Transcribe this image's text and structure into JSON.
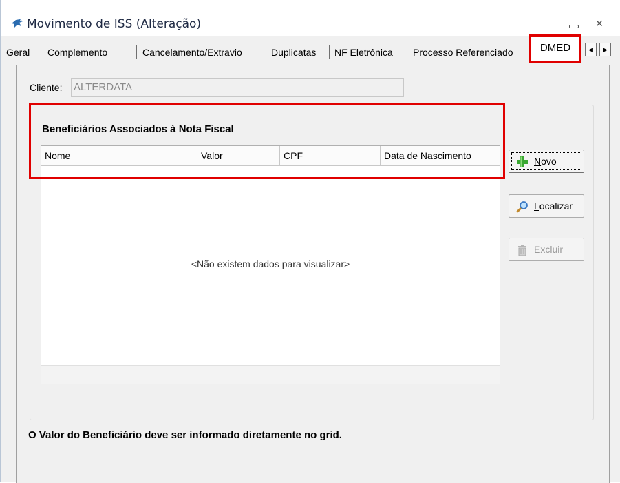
{
  "window": {
    "title": "Movimento de ISS (Alteração)",
    "min_glyph": "",
    "close_glyph": "✕"
  },
  "tabs": [
    {
      "label": "Geral"
    },
    {
      "label": "Complemento"
    },
    {
      "label": "Cancelamento/Extravio"
    },
    {
      "label": "Duplicatas"
    },
    {
      "label": "NF Eletrônica"
    },
    {
      "label": "Processo Referenciado"
    },
    {
      "label": "DMED",
      "active": true
    }
  ],
  "tab_scroll": {
    "left": "◀",
    "right": "▶"
  },
  "cliente": {
    "label": "Cliente:",
    "value": "ALTERDATA"
  },
  "beneficiarios": {
    "title": "Beneficiários Associados à Nota Fiscal",
    "columns": [
      "Nome",
      "Valor",
      "CPF",
      "Data de Nascimento"
    ],
    "empty_message": "<Não existem dados para visualizar>",
    "footer_mark": "|"
  },
  "buttons": {
    "novo": {
      "label_first": "N",
      "label_rest": "ovo",
      "icon": "plus-icon"
    },
    "localizar": {
      "label_first": "L",
      "label_rest": "ocalizar",
      "icon": "magnifier-icon"
    },
    "excluir": {
      "label_first": "E",
      "label_rest": "xcluir",
      "icon": "trash-icon",
      "disabled": true
    }
  },
  "note": "O Valor do Beneficiário deve ser informado diretamente no grid.",
  "colors": {
    "highlight": "#e00000",
    "plus_green": "#3aa832"
  }
}
